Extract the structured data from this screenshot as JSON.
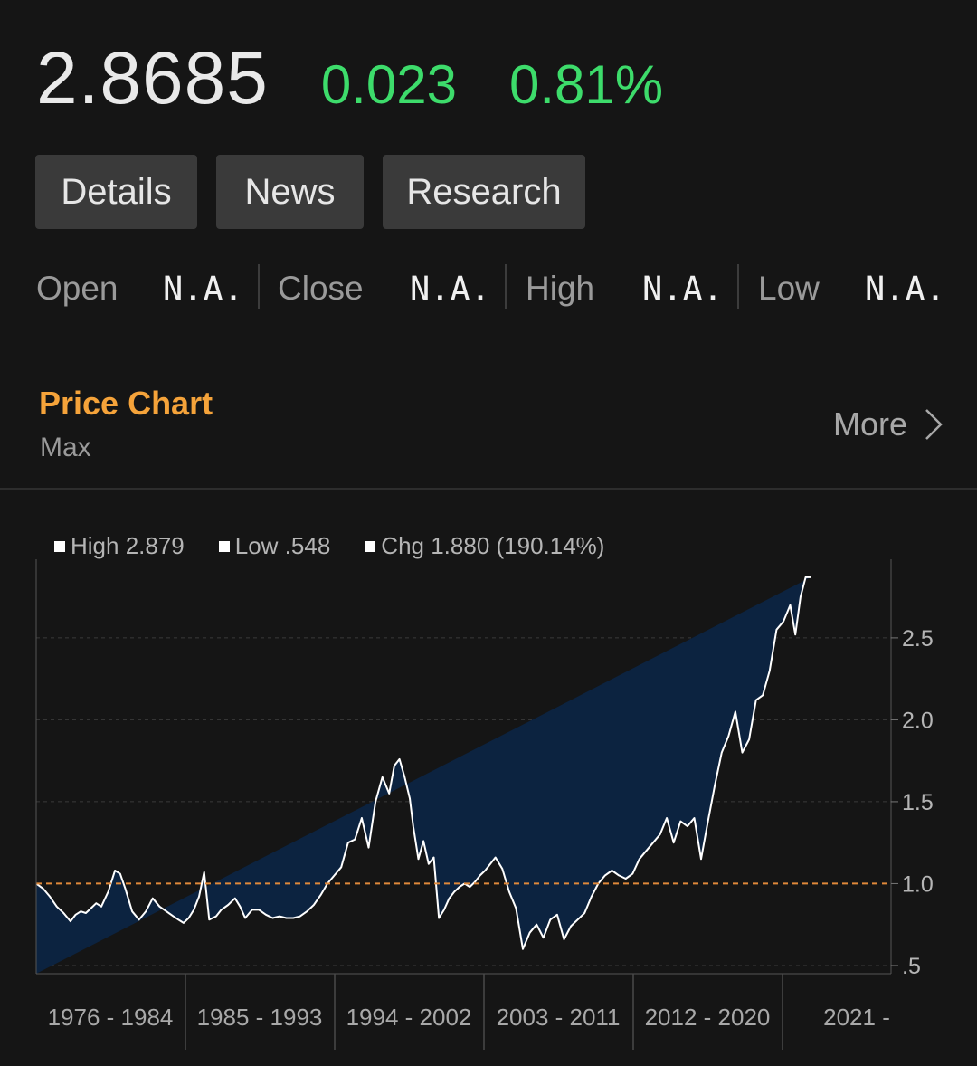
{
  "quote": {
    "price": "2.8685",
    "change": "0.023",
    "change_pct": "0.81%"
  },
  "tabs": [
    "Details",
    "News",
    "Research"
  ],
  "stats": [
    {
      "label": "Open",
      "value": "N.A."
    },
    {
      "label": "Close",
      "value": "N.A."
    },
    {
      "label": "High",
      "value": "N.A."
    },
    {
      "label": "Low",
      "value": "N.A."
    }
  ],
  "section": {
    "title": "Price Chart",
    "subtitle": "Max",
    "more_label": "More"
  },
  "legend": {
    "high": "High 2.879",
    "low": "Low .548",
    "chg": "Chg 1.880 (190.14%)"
  },
  "colors": {
    "accent": "#f5a33a",
    "positive": "#3ddc6b",
    "area_fill": "#0c2340",
    "line": "#ffffff",
    "reference": "#e0893a"
  },
  "chart_data": {
    "type": "area",
    "title": "",
    "xlabel": "",
    "ylabel": "",
    "ylim": [
      0.45,
      2.98
    ],
    "xlim": [
      1976,
      2024.3
    ],
    "reference_line": 1.0,
    "y_ticks": [
      ".5",
      "1.0",
      "1.5",
      "2.0",
      "2.5"
    ],
    "y_tick_values": [
      0.5,
      1.0,
      1.5,
      2.0,
      2.5
    ],
    "x_categories": [
      "1976 - 1984",
      "1985 - 1993",
      "1994 - 2002",
      "2003 - 2011",
      "2012 - 2020",
      "2021 -"
    ],
    "grid": "horizontal dashed",
    "x": [
      1976.0,
      1976.4,
      1976.8,
      1977.2,
      1977.6,
      1978.0,
      1978.3,
      1978.6,
      1978.9,
      1979.2,
      1979.5,
      1979.8,
      1980.2,
      1980.6,
      1980.9,
      1981.2,
      1981.6,
      1982.0,
      1982.4,
      1982.8,
      1983.2,
      1983.6,
      1984.0,
      1984.3,
      1984.6,
      1984.9,
      1985.2,
      1985.5,
      1985.8,
      1986.1,
      1986.5,
      1986.8,
      1987.2,
      1987.6,
      1987.9,
      1988.2,
      1988.6,
      1989.0,
      1989.4,
      1989.8,
      1990.2,
      1990.6,
      1991.0,
      1991.4,
      1991.8,
      1992.2,
      1992.6,
      1993.0,
      1993.4,
      1993.8,
      1994.2,
      1994.6,
      1995.0,
      1995.4,
      1995.8,
      1996.2,
      1996.6,
      1996.9,
      1997.2,
      1997.5,
      1997.8,
      1998.0,
      1998.3,
      1998.6,
      1998.9,
      1999.2,
      1999.5,
      1999.8,
      2000.1,
      2000.4,
      2000.7,
      2001.0,
      2001.3,
      2001.6,
      2001.9,
      2002.2,
      2002.5,
      2002.8,
      2003.2,
      2003.6,
      2004.0,
      2004.4,
      2004.8,
      2005.2,
      2005.6,
      2006.0,
      2006.4,
      2006.8,
      2007.2,
      2007.6,
      2008.0,
      2008.4,
      2008.8,
      2009.2,
      2009.6,
      2010.0,
      2010.4,
      2010.8,
      2011.2,
      2011.6,
      2012.0,
      2012.4,
      2012.8,
      2013.2,
      2013.6,
      2014.0,
      2014.4,
      2014.8,
      2015.2,
      2015.6,
      2016.0,
      2016.4,
      2016.8,
      2017.2,
      2017.6,
      2018.0,
      2018.4,
      2018.8,
      2019.2,
      2019.6,
      2020.0,
      2020.3,
      2020.6,
      2020.9,
      2021.2,
      2021.5,
      2021.8,
      2022.1,
      2022.4,
      2022.7,
      2023.0,
      2023.3,
      2023.6,
      2023.9,
      2024.2
    ],
    "y": [
      1.0,
      0.97,
      0.92,
      0.86,
      0.82,
      0.77,
      0.81,
      0.83,
      0.82,
      0.85,
      0.88,
      0.86,
      0.95,
      1.08,
      1.06,
      0.97,
      0.83,
      0.78,
      0.83,
      0.91,
      0.86,
      0.83,
      0.8,
      0.78,
      0.76,
      0.79,
      0.84,
      0.92,
      1.07,
      0.78,
      0.8,
      0.84,
      0.87,
      0.91,
      0.86,
      0.79,
      0.84,
      0.84,
      0.81,
      0.79,
      0.8,
      0.79,
      0.79,
      0.8,
      0.83,
      0.87,
      0.93,
      1.0,
      1.05,
      1.1,
      1.25,
      1.27,
      1.4,
      1.22,
      1.5,
      1.65,
      1.55,
      1.72,
      1.76,
      1.65,
      1.52,
      1.35,
      1.15,
      1.26,
      1.12,
      1.16,
      0.79,
      0.84,
      0.91,
      0.95,
      0.98,
      1.0,
      0.98,
      1.01,
      1.05,
      1.08,
      1.12,
      1.16,
      1.09,
      0.95,
      0.85,
      0.6,
      0.7,
      0.75,
      0.67,
      0.78,
      0.81,
      0.66,
      0.74,
      0.78,
      0.82,
      0.92,
      1.0,
      1.05,
      1.08,
      1.05,
      1.03,
      1.06,
      1.15,
      1.2,
      1.25,
      1.3,
      1.4,
      1.25,
      1.38,
      1.35,
      1.4,
      1.15,
      1.38,
      1.6,
      1.8,
      1.9,
      2.05,
      1.8,
      1.88,
      2.12,
      2.15,
      2.3,
      2.55,
      2.6,
      2.7,
      2.52,
      2.75,
      2.87,
      2.87
    ]
  }
}
